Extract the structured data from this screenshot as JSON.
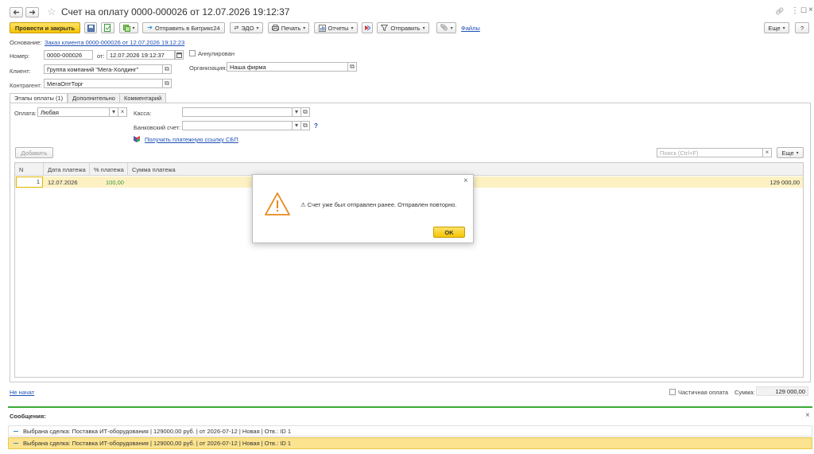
{
  "window": {
    "title": "Счет на оплату 0000-000026 от 12.07.2026 19:12:37",
    "back_icon": "arrow-left-icon",
    "forward_icon": "arrow-right-icon",
    "favorite_icon": "star-icon",
    "link_icon": "link-icon",
    "menu_icon": "more-vertical-icon",
    "maximize_icon": "maximize-icon",
    "close_icon": "close-icon"
  },
  "toolbar": {
    "post_close": "Провести и закрыть",
    "send_bitrix": "Отправить в Битрикс24",
    "edo": "ЭДО",
    "print": "Печать",
    "reports": "Отчеты",
    "send": "Отправить",
    "files": "Файлы",
    "more": "Еще",
    "help": "?"
  },
  "header": {
    "basis_label": "Основание:",
    "basis_link": "Заказ клиента 0000-000026 от 12.07.2026 19:12:23",
    "number_label": "Номер:",
    "number_value": "0000-000026",
    "from_label": "от:",
    "date_value": "12.07.2026 19:12:37",
    "annulled_label": "Аннулирован",
    "client_label": "Клиент:",
    "client_value": "Группа компаний \"Мега-Холдинг\"",
    "org_label": "Организация:",
    "org_value": "Наша фирма",
    "contractor_label": "Контрагент:",
    "contractor_value": "МегаОптТорг"
  },
  "tabs": [
    {
      "label": "Этапы оплаты (1)"
    },
    {
      "label": "Дополнительно"
    },
    {
      "label": "Комментарий"
    }
  ],
  "payment": {
    "pay_label": "Оплата:",
    "pay_value": "Любая",
    "cash_label": "Касса:",
    "bank_label": "Банковский счет:",
    "help": "?",
    "sbp_link": "Получить платежную ссылку СБП",
    "add_button": "Добавить",
    "search_placeholder": "Поиск (Ctrl+F)",
    "more": "Еще"
  },
  "table": {
    "columns": [
      "N",
      "Дата платежа",
      "% платежа",
      "Сумма платежа"
    ],
    "rows": [
      {
        "n": "1",
        "date": "12.07.2026",
        "percent": "100,00",
        "amount": "129 000,00"
      }
    ]
  },
  "footer": {
    "status_link": "Не начат",
    "partial_label": "Частичная оплата",
    "sum_label": "Сумма:",
    "sum_value": "129 000,00"
  },
  "messages": {
    "title": "Сообщения:",
    "items": [
      "Выбрана сделка: Поставка ИТ-оборудования | 129000,00 руб. | от 2026-07-12 | Новая | Отв.: ID 1",
      "Выбрана сделка: Поставка ИТ-оборудования | 129000,00 руб. | от 2026-07-12 | Новая | Отв.: ID 1"
    ]
  },
  "dialog": {
    "message": "⚠ Счет уже был отправлен ранее. Отправлен повторно.",
    "ok": "OK",
    "warning_icon": "warning-icon"
  },
  "colors": {
    "accent_yellow": "#f5c400",
    "link_blue": "#1f4fb5",
    "selected_row": "#fdf1c4",
    "messages_border": "#3aaa35"
  }
}
